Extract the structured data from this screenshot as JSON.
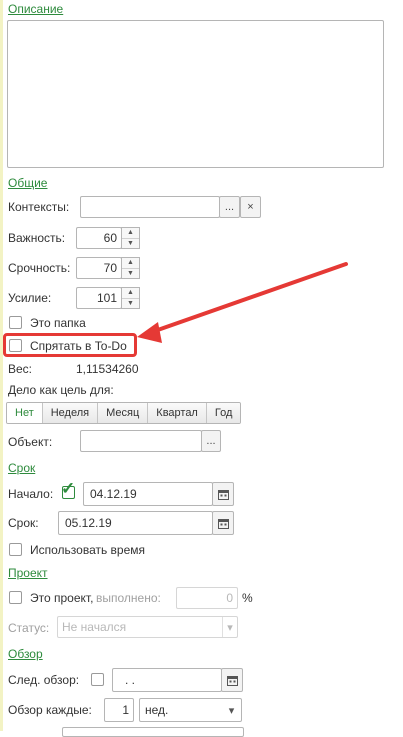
{
  "sections": {
    "description": "Описание",
    "general": "Общие",
    "deadline": "Срок",
    "project": "Проект",
    "review": "Обзор"
  },
  "fields": {
    "contexts_label": "Контексты:",
    "contexts_value": "",
    "importance_label": "Важность:",
    "importance_value": "60",
    "urgency_label": "Срочность:",
    "urgency_value": "70",
    "effort_label": "Усилие:",
    "effort_value": "101",
    "is_folder_label": "Это папка",
    "hide_todo_label": "Спрятать в To-Do",
    "weight_label": "Вес:",
    "weight_value": "1,11534260",
    "goal_label": "Дело как цель для:",
    "goal_options": [
      "Нет",
      "Неделя",
      "Месяц",
      "Квартал",
      "Год"
    ],
    "goal_selected": "Нет",
    "object_label": "Объект:",
    "start_label": "Начало:",
    "start_value": "04.12.19",
    "deadline_label": "Срок:",
    "deadline_value": "05.12.19",
    "use_time_label": "Использовать время",
    "is_project_label": "Это проект,",
    "done_label": "выполнено:",
    "done_value": "0",
    "percent_sign": "%",
    "status_label": "Статус:",
    "status_value": "Не начался",
    "next_review_label": "След. обзор:",
    "next_review_value": ".  .",
    "review_every_label": "Обзор каждые:",
    "review_every_value": "1",
    "review_unit": "нед."
  },
  "glyphs": {
    "ellipsis": "...",
    "clear": "×",
    "up": "▲",
    "down": "▼",
    "check": "✓",
    "dropdown": "▾"
  },
  "colors": {
    "section_link": "#2e8b3d",
    "annotation": "#e53935",
    "check": "#2e8b3d"
  }
}
